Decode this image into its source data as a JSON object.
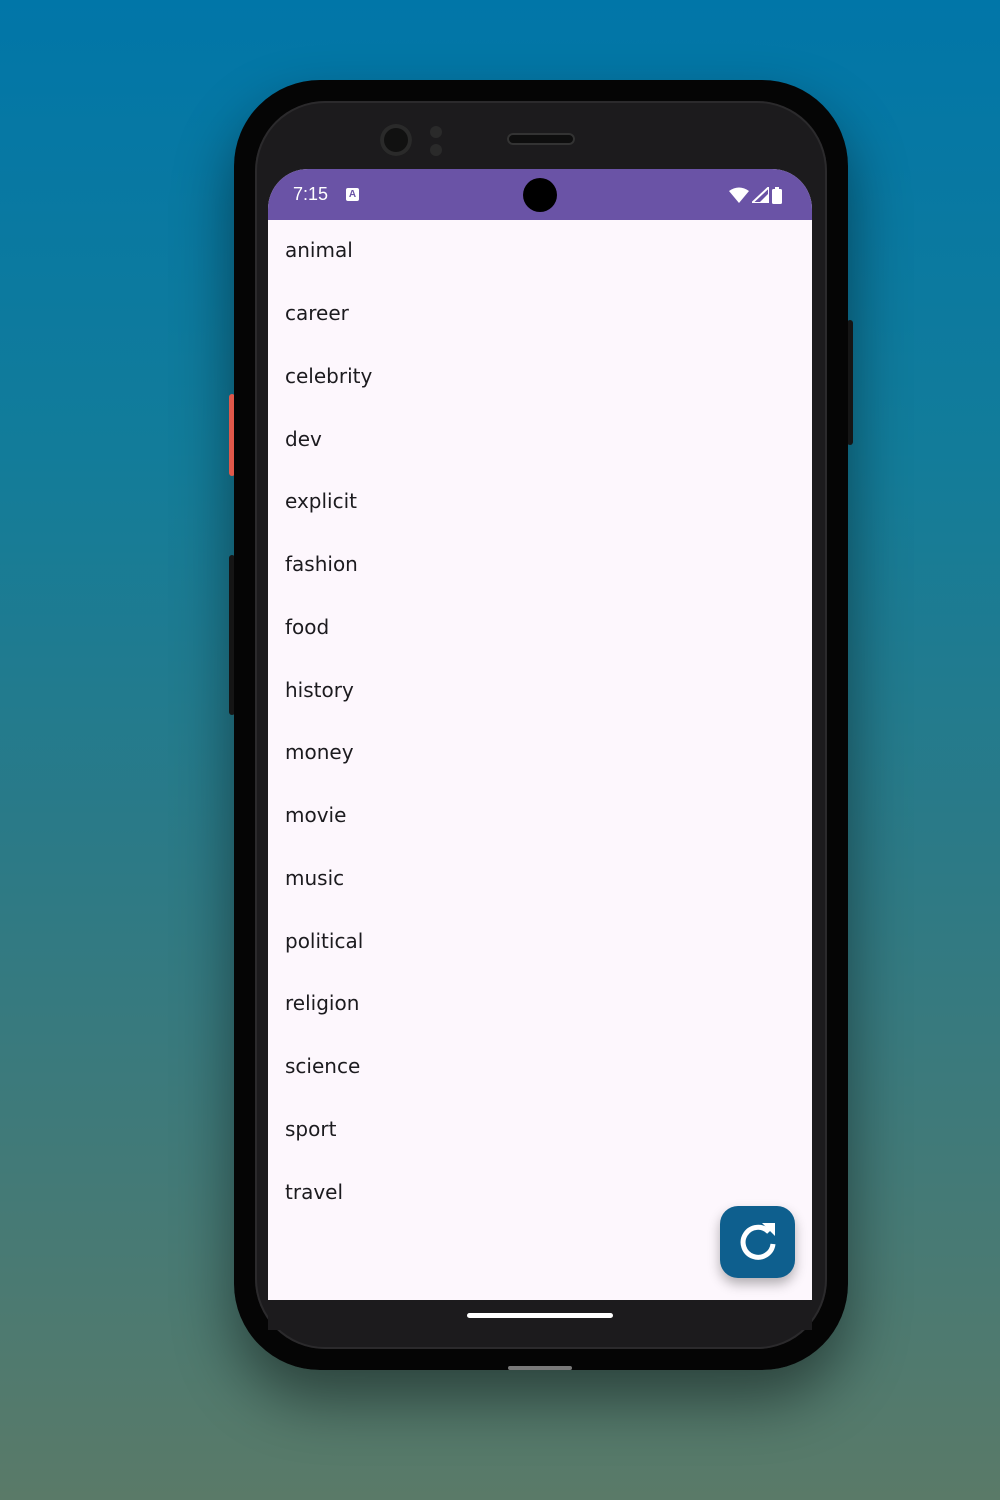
{
  "status_bar": {
    "time": "7:15",
    "notification_icon_letter": "A",
    "background_color": "#6a53a6",
    "icons": [
      "wifi-icon",
      "signal-icon",
      "battery-icon"
    ]
  },
  "category_list": {
    "items": [
      "animal",
      "career",
      "celebrity",
      "dev",
      "explicit",
      "fashion",
      "food",
      "history",
      "money",
      "movie",
      "music",
      "political",
      "religion",
      "science",
      "sport",
      "travel"
    ]
  },
  "fab": {
    "icon": "refresh-icon",
    "color": "#0e5f8e"
  },
  "colors": {
    "screen_background": "#fdf7fd",
    "text": "#1c1b1f"
  }
}
